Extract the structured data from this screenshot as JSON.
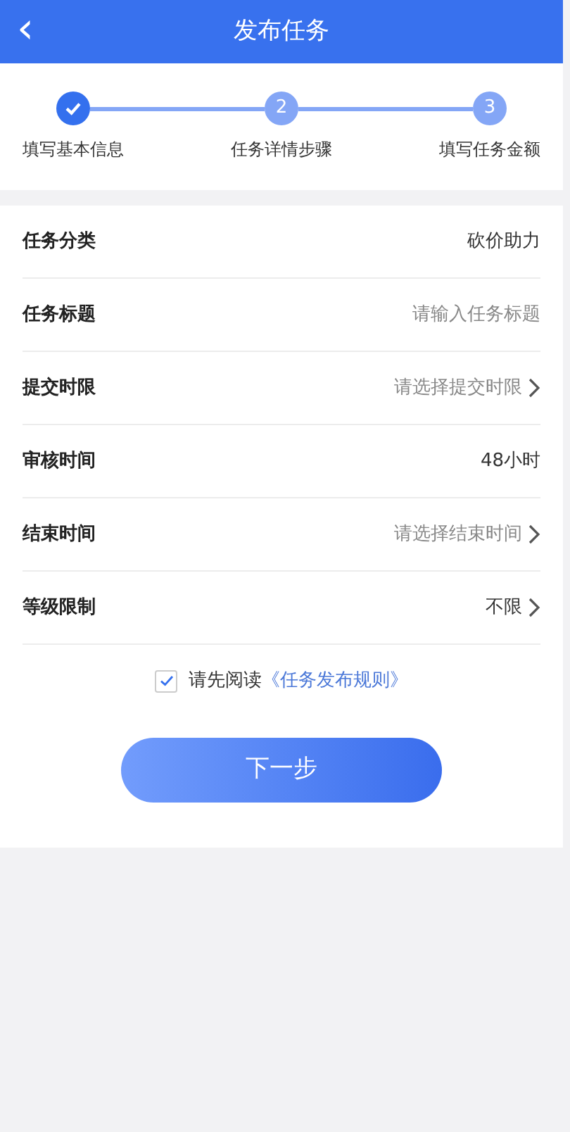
{
  "header": {
    "back": "‹",
    "title": "发布任务"
  },
  "steps": [
    {
      "label": "填写基本信息",
      "done": true
    },
    {
      "label": "任务详情步骤",
      "done": false,
      "number": "2"
    },
    {
      "label": "填写任务金额",
      "done": false,
      "number": "3"
    }
  ],
  "form": [
    {
      "label": "任务分类",
      "kind": "text",
      "value": "砍价助力"
    },
    {
      "label": "任务标题",
      "kind": "input",
      "placeholder": "请输入任务标题"
    },
    {
      "label": "提交时限",
      "kind": "select",
      "placeholder": "请选择提交时限"
    },
    {
      "label": "审核时间",
      "kind": "text",
      "value": "48小时"
    },
    {
      "label": "结束时间",
      "kind": "select",
      "placeholder": "请选择结束时间"
    },
    {
      "label": "等级限制",
      "kind": "select",
      "value": "不限"
    }
  ],
  "agreement": {
    "checked": true,
    "text": "请先阅读",
    "link": "《任务发布规则》"
  },
  "next_button": "下一步"
}
